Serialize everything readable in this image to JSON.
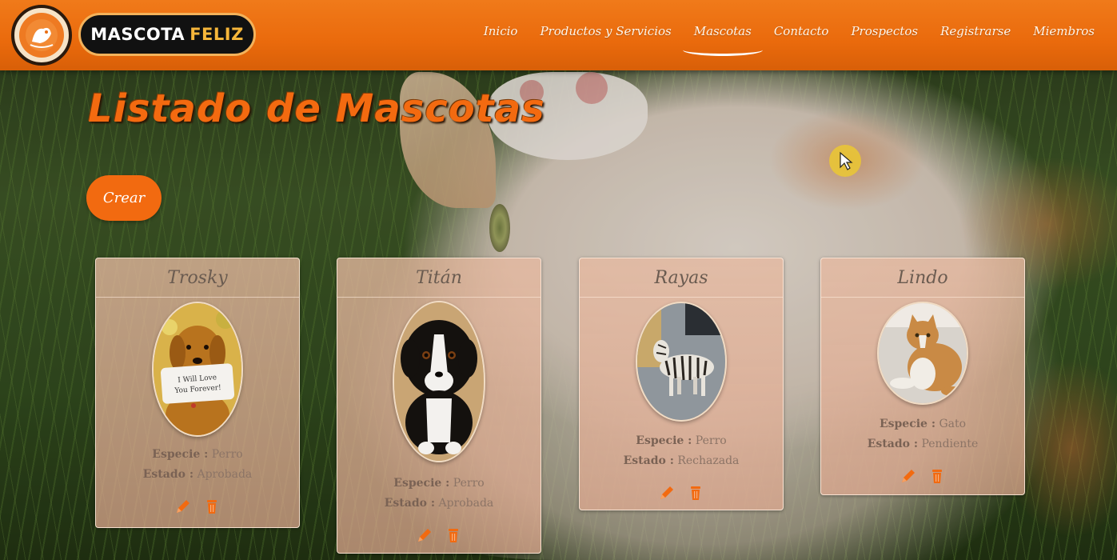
{
  "brand": {
    "name_part1": "MASCOTA",
    "name_part2": "FELIZ"
  },
  "nav": {
    "items": [
      "Inicio",
      "Productos y Servicios",
      "Mascotas",
      "Contacto",
      "Prospectos",
      "Registrarse",
      "Miembros"
    ],
    "active": "Mascotas"
  },
  "page": {
    "title": "Listado de Mascotas",
    "create_label": "Crear"
  },
  "labels": {
    "species": "Especie :",
    "status": "Estado :"
  },
  "pets": [
    {
      "name": "Trosky",
      "species": "Perro",
      "status": "Aprobada",
      "photo_note": "golden retriever holding sign"
    },
    {
      "name": "Titán",
      "species": "Perro",
      "status": "Aprobada",
      "photo_note": "bernese puppy"
    },
    {
      "name": "Rayas",
      "species": "Perro",
      "status": "Rechazada",
      "photo_note": "striped dog"
    },
    {
      "name": "Lindo",
      "species": "Gato",
      "status": "Pendiente",
      "photo_note": "orange and white cat"
    }
  ],
  "photo_sign_text": "I Will Love You Forever!",
  "colors": {
    "brand": "#ea6a0c",
    "accent": "#f6b63a",
    "title": "#f36a10",
    "icon": "#f26a10"
  }
}
